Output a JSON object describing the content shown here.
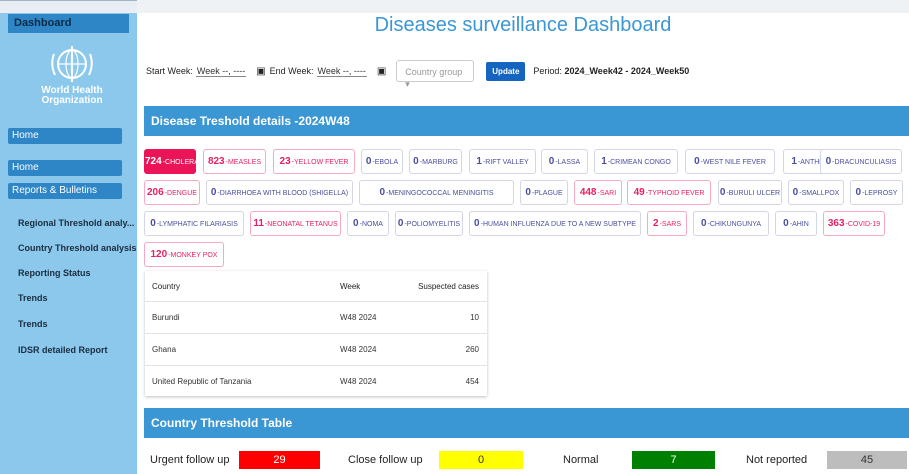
{
  "sidebar": {
    "header": "Dashboard",
    "logo_line1": "World Health",
    "logo_line2": "Organization",
    "home_button": "Home",
    "nav_home": "Home",
    "nav_reports": "Reports & Bulletins",
    "items": [
      "Regional Threshold analy...",
      "Country Threshold analysis",
      "Reporting Status",
      "Trends",
      "Trends",
      "IDSR detailed Report"
    ]
  },
  "header": {
    "title": "Diseases surveillance Dashboard"
  },
  "filters": {
    "start_label": "Start Week:",
    "start_value": "Week --, ----",
    "end_label": "End Week:",
    "end_value": "Week --, ----",
    "country_group_placeholder": "Country group",
    "update_label": "Update",
    "period_label": "Period:",
    "period_value": "2024_Week42 - 2024_Week50"
  },
  "threshold": {
    "title": "Disease Treshold details -2024W48",
    "chips": [
      {
        "count": "724",
        "name": "CHOLERA",
        "state": "active"
      },
      {
        "count": "823",
        "name": "MEASLES",
        "state": "alert"
      },
      {
        "count": "23",
        "name": "YELLOW FEVER",
        "state": "alert"
      },
      {
        "count": "0",
        "name": "EBOLA",
        "state": "normal"
      },
      {
        "count": "0",
        "name": "MARBURG",
        "state": "normal"
      },
      {
        "count": "1",
        "name": "RIFT VALLEY",
        "state": "normal"
      },
      {
        "count": "0",
        "name": "LASSA",
        "state": "normal"
      },
      {
        "count": "1",
        "name": "CRIMEAN CONGO",
        "state": "normal"
      },
      {
        "count": "0",
        "name": "WEST NILE FEVER",
        "state": "normal"
      },
      {
        "count": "1",
        "name": "ANTHRAX",
        "state": "normal"
      },
      {
        "count": "0",
        "name": "DRACUNCULIASIS",
        "state": "normal"
      },
      {
        "count": "206",
        "name": "DENGUE",
        "state": "alert"
      },
      {
        "count": "0",
        "name": "DIARRHOEA WITH BLOOD (SHIGELLA)",
        "state": "normal"
      },
      {
        "count": "0",
        "name": "MENINGOCOCCAL MENINGITIS",
        "state": "normal"
      },
      {
        "count": "0",
        "name": "PLAGUE",
        "state": "normal"
      },
      {
        "count": "448",
        "name": "SARI",
        "state": "alert"
      },
      {
        "count": "49",
        "name": "TYPHOID FEVER",
        "state": "alert"
      },
      {
        "count": "0",
        "name": "BURULI ULCER",
        "state": "normal"
      },
      {
        "count": "0",
        "name": "SMALLPOX",
        "state": "normal"
      },
      {
        "count": "0",
        "name": "LEPROSY",
        "state": "normal"
      },
      {
        "count": "0",
        "name": "LYMPHATIC FILARIASIS",
        "state": "normal"
      },
      {
        "count": "11",
        "name": "NEONATAL TETANUS",
        "state": "alert"
      },
      {
        "count": "0",
        "name": "NOMA",
        "state": "normal"
      },
      {
        "count": "0",
        "name": "POLIOMYELITIS",
        "state": "normal"
      },
      {
        "count": "0",
        "name": "HUMAN INFLUENZA DUE TO A NEW SUBTYPE",
        "state": "normal"
      },
      {
        "count": "2",
        "name": "SARS",
        "state": "alert"
      },
      {
        "count": "0",
        "name": "CHIKUNGUNYA",
        "state": "normal"
      },
      {
        "count": "0",
        "name": "AHIN",
        "state": "normal"
      },
      {
        "count": "363",
        "name": "COVID-19",
        "state": "alert"
      },
      {
        "count": "120",
        "name": "MONKEY POX",
        "state": "alert"
      }
    ]
  },
  "cases_table": {
    "headers": [
      "Country",
      "Week",
      "Suspected cases"
    ],
    "rows": [
      [
        "Burundi",
        "W48 2024",
        "10"
      ],
      [
        "Ghana",
        "W48 2024",
        "260"
      ],
      [
        "United Republic of Tanzania",
        "W48 2024",
        "454"
      ]
    ]
  },
  "country_threshold": {
    "title": "Country Threshold Table",
    "summary": [
      {
        "label": "Urgent follow up",
        "value": "29",
        "color": "#ff0000"
      },
      {
        "label": "Close follow up",
        "value": "0",
        "color": "#ffff00"
      },
      {
        "label": "Normal",
        "value": "7",
        "color": "#008000"
      },
      {
        "label": "Not reported",
        "value": "45",
        "color": "#bdbdbd"
      }
    ]
  },
  "colors": {
    "accent": "#3a97d4",
    "sidebar": "#8bc8ec",
    "alert": "#e91e63"
  }
}
